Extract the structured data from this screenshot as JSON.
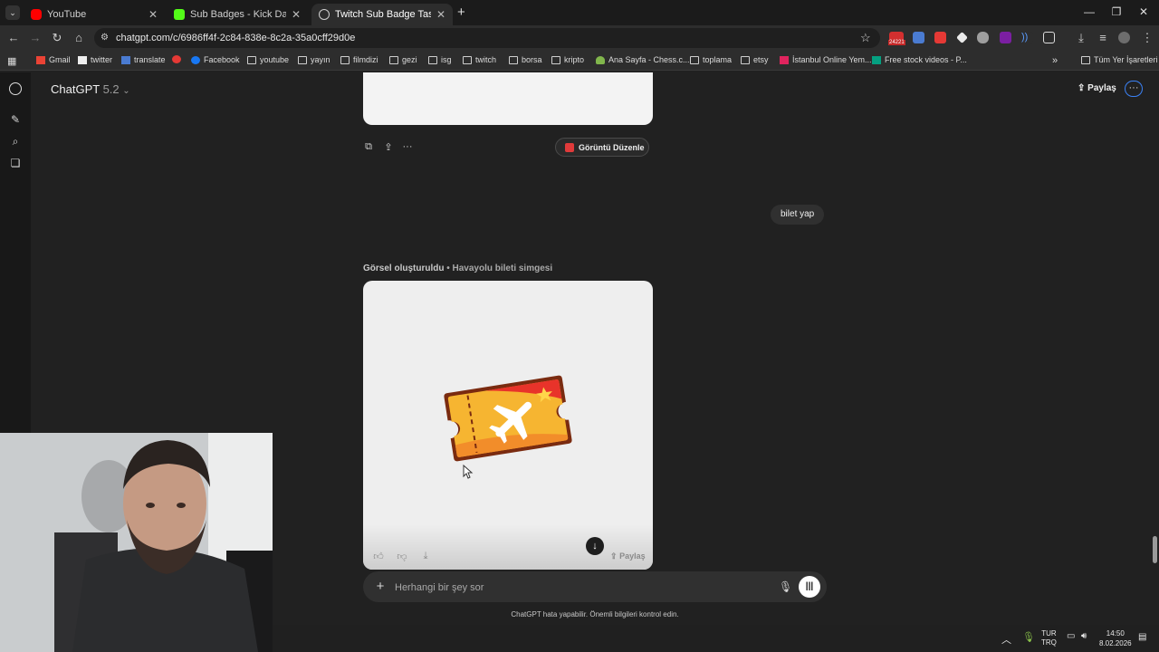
{
  "browser": {
    "tabs": [
      {
        "title": "YouTube",
        "color": "#ff0000"
      },
      {
        "title": "Sub Badges - Kick Dashboard",
        "color": "#53fc18"
      },
      {
        "title": "Twitch Sub Badge Tasarımı",
        "color": "#cfcfcf"
      }
    ],
    "url": "chatgpt.com/c/6986ff4f-2c84-838e-8c2a-35a0cff29d0e",
    "extension_badge": "24221",
    "bookmarks": [
      "Gmail",
      "twitter",
      "translate",
      "Facebook",
      "youtube",
      "yayın",
      "filmdizi",
      "gezi",
      "isg",
      "twitch",
      "borsa",
      "kripto",
      "Ana Sayfa - Chess.c...",
      "toplama",
      "etsy",
      "İstanbul Online Yem...",
      "Free stock videos - P..."
    ],
    "all_bookmarks": "Tüm Yer İşaretleri"
  },
  "app": {
    "model_name": "ChatGPT",
    "model_version": "5.2",
    "share_label": "Paylaş"
  },
  "conversation": {
    "edit_image_label": "Görüntü Düzenle",
    "user_message": "bilet yap",
    "image_status": "Görsel oluşturuldu",
    "image_caption": "Havayolu bileti simgesi",
    "image_share_label": "Paylaş"
  },
  "composer": {
    "placeholder": "Herhangi bir şey sor",
    "disclaimer": "ChatGPT hata yapabilir. Önemli bilgileri kontrol edin."
  },
  "taskbar": {
    "lang_1": "TUR",
    "lang_2": "TRQ",
    "time": "14:50",
    "date": "8.02.2026"
  },
  "colors": {
    "background": "#212121",
    "accent": "#3b82f6",
    "ticket_yellow": "#f7b733",
    "ticket_red": "#e8332a"
  }
}
